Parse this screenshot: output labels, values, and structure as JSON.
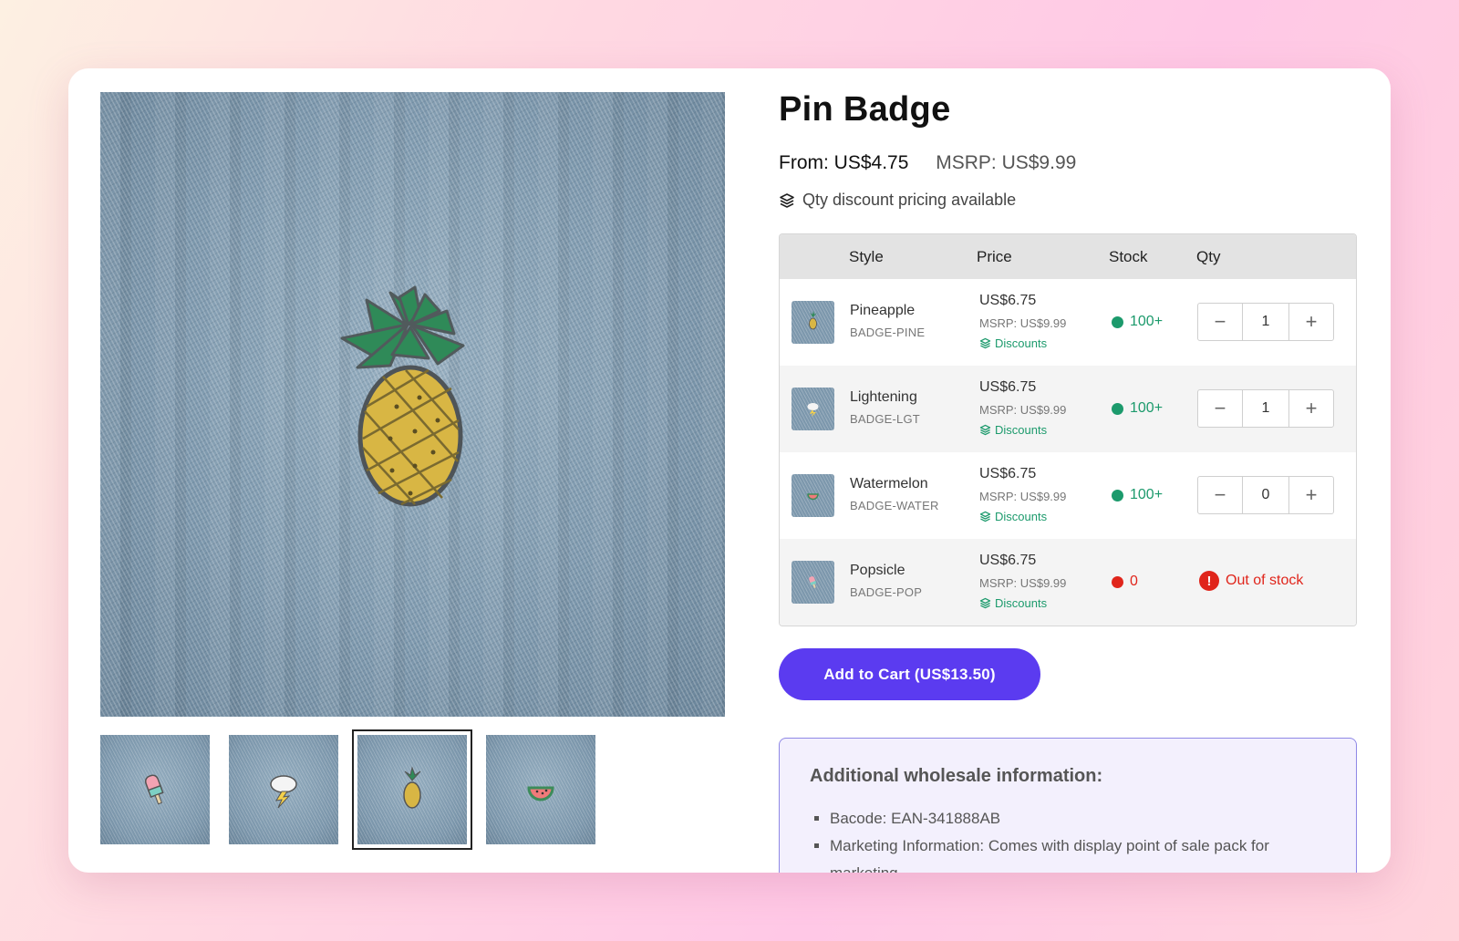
{
  "product": {
    "title": "Pin Badge",
    "price_from": "From: US$4.75",
    "msrp": "MSRP: US$9.99",
    "discount_note": "Qty discount pricing available"
  },
  "gallery": {
    "main_image": "pineapple-pin-on-denim",
    "thumbnails": [
      {
        "name": "popsicle-pin-on-denim",
        "selected": false
      },
      {
        "name": "lightning-cloud-pin-on-denim",
        "selected": false
      },
      {
        "name": "pineapple-pin-on-denim",
        "selected": true
      },
      {
        "name": "watermelon-pin-on-denim",
        "selected": false
      }
    ]
  },
  "table": {
    "headers": {
      "style": "Style",
      "price": "Price",
      "stock": "Stock",
      "qty": "Qty"
    },
    "rows": [
      {
        "style": "Pineapple",
        "sku": "BADGE-PINE",
        "price": "US$6.75",
        "msrp": "MSRP: US$9.99",
        "discounts": "Discounts",
        "stock": "100+",
        "qty": "1"
      },
      {
        "style": "Lightening",
        "sku": "BADGE-LGT",
        "price": "US$6.75",
        "msrp": "MSRP: US$9.99",
        "discounts": "Discounts",
        "stock": "100+",
        "qty": "1"
      },
      {
        "style": "Watermelon",
        "sku": "BADGE-WATER",
        "price": "US$6.75",
        "msrp": "MSRP: US$9.99",
        "discounts": "Discounts",
        "stock": "100+",
        "qty": "0"
      },
      {
        "style": "Popsicle",
        "sku": "BADGE-POP",
        "price": "US$6.75",
        "msrp": "MSRP: US$9.99",
        "discounts": "Discounts",
        "stock": "0",
        "status": "Out of stock",
        "status_icon": "!"
      }
    ]
  },
  "stepper": {
    "minus": "−",
    "plus": "+"
  },
  "cart": {
    "label": "Add to Cart (US$13.50)"
  },
  "wholesale": {
    "heading": "Additional wholesale information:",
    "items": [
      "Bacode: EAN-341888AB",
      "Marketing Information: Comes with display point of sale pack for marketing."
    ]
  },
  "colors": {
    "accent": "#5b3bf0",
    "in_stock": "#1c9a6c",
    "out_of_stock": "#e0251b",
    "discount_link": "#1c9a6c"
  }
}
